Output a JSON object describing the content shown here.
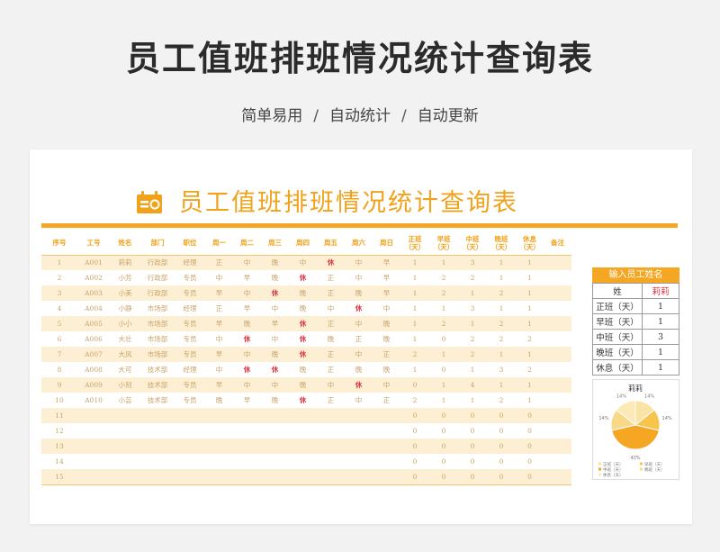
{
  "header": {
    "title": "员工值班排班情况统计查询表",
    "subtitle_parts": [
      "简单易用",
      "自动统计",
      "自动更新"
    ],
    "separator": "/"
  },
  "sheet": {
    "title": "员工值班排班情况统计查询表",
    "columns": [
      "序号",
      "工号",
      "姓名",
      "部门",
      "职位",
      "周一",
      "周二",
      "周三",
      "周四",
      "周五",
      "周六",
      "周日",
      "正班\n（天）",
      "早班\n（天）",
      "中班\n（天）",
      "晚班\n（天）",
      "休息\n（天）",
      "备注"
    ],
    "rows": [
      [
        "1",
        "A001",
        "莉莉",
        "行政部",
        "经理",
        "正",
        "中",
        "晚",
        "中",
        "休",
        "中",
        "早",
        "1",
        "1",
        "3",
        "1",
        "1",
        ""
      ],
      [
        "2",
        "A002",
        "小芳",
        "行政部",
        "专员",
        "中",
        "早",
        "晚",
        "休",
        "正",
        "中",
        "早",
        "1",
        "2",
        "2",
        "1",
        "1",
        ""
      ],
      [
        "3",
        "A003",
        "小美",
        "行政部",
        "专员",
        "早",
        "中",
        "休",
        "晚",
        "正",
        "晚",
        "早",
        "1",
        "2",
        "1",
        "2",
        "1",
        ""
      ],
      [
        "4",
        "A004",
        "小静",
        "市场部",
        "经理",
        "正",
        "早",
        "中",
        "晚",
        "中",
        "休",
        "中",
        "1",
        "1",
        "3",
        "1",
        "1",
        ""
      ],
      [
        "5",
        "A005",
        "小小",
        "市场部",
        "专员",
        "早",
        "晚",
        "早",
        "休",
        "正",
        "中",
        "晚",
        "1",
        "2",
        "1",
        "2",
        "1",
        ""
      ],
      [
        "6",
        "A006",
        "大壮",
        "市场部",
        "专员",
        "中",
        "休",
        "中",
        "休",
        "晚",
        "正",
        "晚",
        "1",
        "0",
        "2",
        "2",
        "2",
        ""
      ],
      [
        "7",
        "A007",
        "大风",
        "市场部",
        "专员",
        "早",
        "中",
        "晚",
        "休",
        "正",
        "中",
        "正",
        "2",
        "1",
        "2",
        "1",
        "1",
        ""
      ],
      [
        "8",
        "A008",
        "大可",
        "技术部",
        "经理",
        "中",
        "休",
        "休",
        "晚",
        "正",
        "晚",
        "晚",
        "1",
        "0",
        "1",
        "3",
        "2",
        ""
      ],
      [
        "9",
        "A009",
        "小刻",
        "技术部",
        "专员",
        "早",
        "中",
        "中",
        "晚",
        "中",
        "休",
        "中",
        "0",
        "1",
        "4",
        "1",
        "1",
        ""
      ],
      [
        "10",
        "A010",
        "小芸",
        "技术部",
        "专员",
        "晚",
        "早",
        "晚",
        "休",
        "正",
        "中",
        "正",
        "2",
        "1",
        "1",
        "2",
        "1",
        ""
      ],
      [
        "11",
        "",
        "",
        "",
        "",
        "",
        "",
        "",
        "",
        "",
        "",
        "",
        "0",
        "0",
        "0",
        "0",
        "0",
        ""
      ],
      [
        "12",
        "",
        "",
        "",
        "",
        "",
        "",
        "",
        "",
        "",
        "",
        "",
        "0",
        "0",
        "0",
        "0",
        "0",
        ""
      ],
      [
        "13",
        "",
        "",
        "",
        "",
        "",
        "",
        "",
        "",
        "",
        "",
        "",
        "0",
        "0",
        "0",
        "0",
        "0",
        ""
      ],
      [
        "14",
        "",
        "",
        "",
        "",
        "",
        "",
        "",
        "",
        "",
        "",
        "",
        "0",
        "0",
        "0",
        "0",
        "0",
        ""
      ],
      [
        "15",
        "",
        "",
        "",
        "",
        "",
        "",
        "",
        "",
        "",
        "",
        "",
        "0",
        "0",
        "0",
        "0",
        "0",
        ""
      ]
    ]
  },
  "lookup": {
    "header": "输入员工姓名",
    "name_label": "姓",
    "name_value": "莉莉",
    "items": [
      {
        "label": "正班（天）",
        "value": "1"
      },
      {
        "label": "早班（天）",
        "value": "1"
      },
      {
        "label": "中班（天）",
        "value": "3"
      },
      {
        "label": "晚班（天）",
        "value": "1"
      },
      {
        "label": "休息（天）",
        "value": "1"
      }
    ]
  },
  "chart_data": {
    "type": "pie",
    "title": "莉莉",
    "categories": [
      "正班（天）",
      "早班（天）",
      "中班（天）",
      "晚班（天）",
      "休息（天）"
    ],
    "values": [
      1,
      1,
      3,
      1,
      1
    ],
    "data_labels": [
      "14%",
      "14%",
      "43%",
      "14%",
      "14%"
    ],
    "colors": [
      "#fbe3a6",
      "#f7c54b",
      "#f5a623",
      "#f8d98a",
      "#fde9b8"
    ],
    "legend": "bottom"
  },
  "colors": {
    "accent": "#f5a623",
    "rest": "#e0303a"
  }
}
